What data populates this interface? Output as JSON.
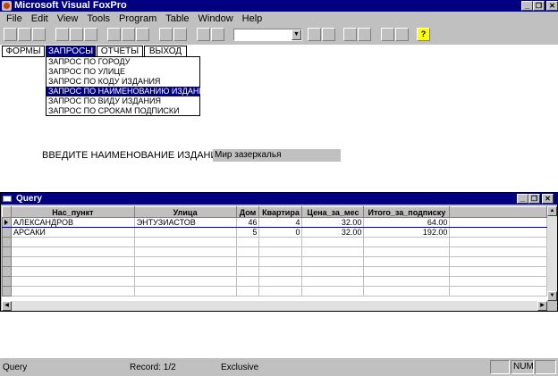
{
  "window": {
    "title": "Microsoft Visual FoxPro",
    "minimize": "_",
    "restore": "❐",
    "close": "✕"
  },
  "menubar": {
    "items": [
      "File",
      "Edit",
      "View",
      "Tools",
      "Program",
      "Table",
      "Window",
      "Help"
    ]
  },
  "toolbar": {
    "combo_value": "",
    "combo_arrow": "▼",
    "help_label": "?",
    "buttons": [
      "new-icon",
      "open-icon",
      "save-icon",
      "print-icon",
      "print-preview-icon",
      "spell-check-icon",
      "cut-icon",
      "copy-icon",
      "paste-icon",
      "undo-icon",
      "redo-icon",
      "run-icon",
      "modify-form-icon",
      "command-window-icon",
      "view-window-icon",
      "form-wizard-icon",
      "report-wizard-icon",
      "autoform-icon",
      "autoreport-icon",
      "help-icon"
    ]
  },
  "custom_menu": {
    "items": [
      "ФОРМЫ",
      "ЗАПРОСЫ",
      "ОТЧЕТЫ",
      "ВЫХОД"
    ],
    "active_index": 1,
    "dropdown": [
      "ЗАПРОС ПО ГОРОДУ",
      "ЗАПРОС ПО УЛИЦЕ",
      "ЗАПРОС ПО КОДУ ИЗДАНИЯ",
      "ЗАПРОС ПО НАИМЕНОВАНИЮ ИЗДАНИЯ",
      "ЗАПРОС ПО ВИДУ ИЗДАНИЯ",
      "ЗАПРОС ПО СРОКАМ ПОДПИСКИ"
    ],
    "dropdown_selected_index": 3
  },
  "prompt": {
    "label": "ВВЕДИТЕ НАИМЕНОВАНИЕ ИЗДАНИЯ",
    "value": "Мир зазеркалья"
  },
  "query_window": {
    "title": "Query",
    "columns": [
      "Нас_пункт",
      "Улица",
      "Дом",
      "Квартира",
      "Цена_за_мес",
      "Итого_за_подписку"
    ],
    "rows": [
      [
        "АЛЕКСАНДРОВ",
        "ЭНТУЗИАСТОВ",
        "46",
        "4",
        "32.00",
        "64.00"
      ],
      [
        "АРСАКИ",
        "",
        "5",
        "0",
        "32.00",
        "192.00"
      ]
    ]
  },
  "statusbar": {
    "left": "Query",
    "record": "Record: 1/2",
    "mode": "Exclusive",
    "num": "NUM"
  },
  "colors": {
    "title_bar": "#000080",
    "face": "#c0c0c0",
    "highlight": "#000080",
    "help_button": "#ffff00"
  }
}
